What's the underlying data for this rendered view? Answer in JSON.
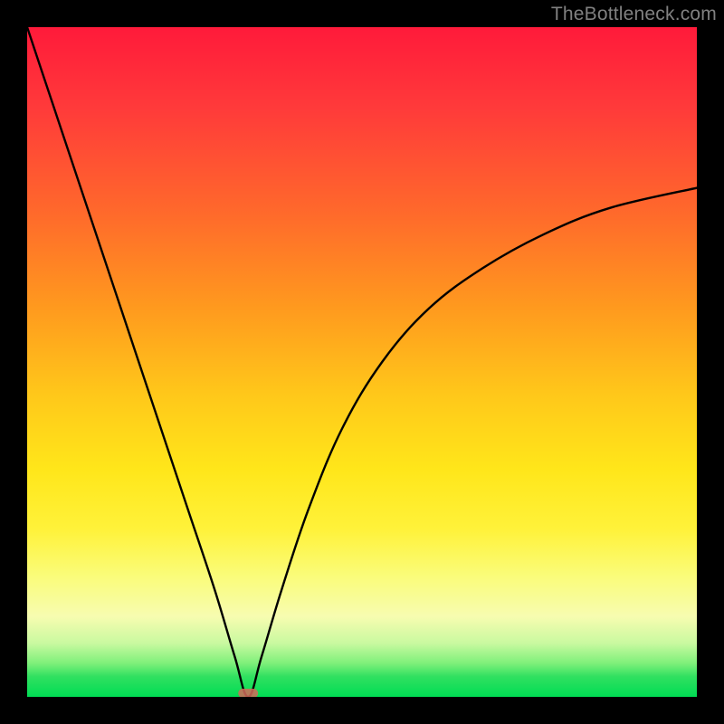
{
  "watermark": "TheBottleneck.com",
  "chart_data": {
    "type": "line",
    "title": "",
    "xlabel": "",
    "ylabel": "",
    "xlim": [
      0,
      100
    ],
    "ylim": [
      0,
      100
    ],
    "grid": false,
    "legend": false,
    "marker": {
      "x": 33,
      "y": 0,
      "color": "#d46a5a"
    },
    "background_gradient": {
      "orientation": "vertical",
      "stops": [
        {
          "pos": 0.0,
          "color": "#ff1a3a"
        },
        {
          "pos": 0.5,
          "color": "#ffb41e"
        },
        {
          "pos": 0.75,
          "color": "#fff23a"
        },
        {
          "pos": 0.92,
          "color": "#c9f9a0"
        },
        {
          "pos": 1.0,
          "color": "#00dc54"
        }
      ]
    },
    "series": [
      {
        "name": "bottleneck-curve",
        "x": [
          0,
          4,
          8,
          12,
          16,
          20,
          24,
          28,
          31,
          33,
          35,
          38,
          42,
          47,
          53,
          60,
          68,
          77,
          87,
          100
        ],
        "values": [
          100,
          88,
          76,
          64,
          52,
          40,
          28,
          16,
          6,
          0,
          6,
          16,
          28,
          40,
          50,
          58,
          64,
          69,
          73,
          76
        ]
      }
    ]
  }
}
